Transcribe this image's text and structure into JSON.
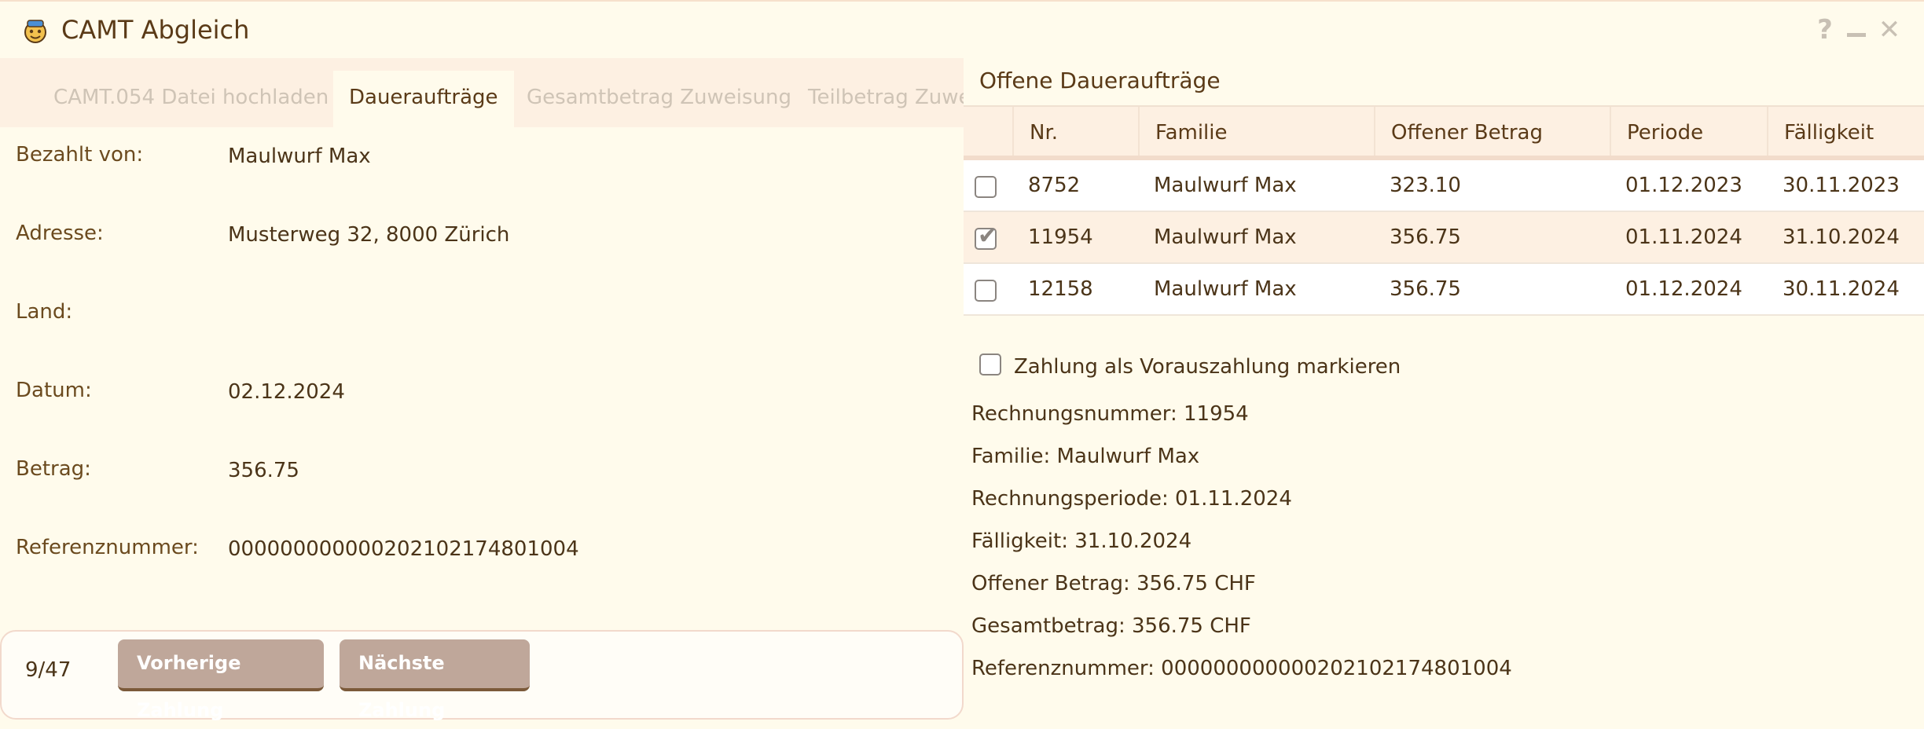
{
  "window": {
    "title": "CAMT Abgleich",
    "help_glyph": "?",
    "minimize_glyph": "_",
    "close_glyph": "✕"
  },
  "tabs": [
    {
      "label": "CAMT.054 Datei hochladen",
      "active": false
    },
    {
      "label": "Daueraufträge",
      "active": true
    },
    {
      "label": "Gesamtbetrag Zuweisung",
      "active": false
    },
    {
      "label": "Teilbetrag Zuweisung",
      "active": false
    }
  ],
  "payment": {
    "fields": [
      {
        "label": "Bezahlt von:",
        "value": "Maulwurf Max"
      },
      {
        "label": "Adresse:",
        "value": "Musterweg 32, 8000 Zürich"
      },
      {
        "label": "Land:",
        "value": ""
      },
      {
        "label": "Datum:",
        "value": "02.12.2024"
      },
      {
        "label": "Betrag:",
        "value": "356.75"
      },
      {
        "label": "Referenznummer:",
        "value": "000000000000202102174801004"
      }
    ],
    "counter": "9/47",
    "prev_label": "Vorherige Zahlung",
    "next_label": "Nächste Zahlung"
  },
  "orders": {
    "title": "Offene Daueraufträge",
    "columns": [
      "",
      "Nr.",
      "Familie",
      "Offener Betrag",
      "Periode",
      "Fälligkeit"
    ],
    "rows": [
      {
        "checked": false,
        "nr": "8752",
        "familie": "Maulwurf Max",
        "betrag": "323.10",
        "periode": "01.12.2023",
        "faelligkeit": "30.11.2023"
      },
      {
        "checked": true,
        "nr": "11954",
        "familie": "Maulwurf Max",
        "betrag": "356.75",
        "periode": "01.11.2024",
        "faelligkeit": "31.10.2024"
      },
      {
        "checked": false,
        "nr": "12158",
        "familie": "Maulwurf Max",
        "betrag": "356.75",
        "periode": "01.12.2024",
        "faelligkeit": "30.11.2024"
      }
    ],
    "prepay_label": "Zahlung als Vorauszahlung markieren",
    "prepay_checked": false
  },
  "details": [
    "Rechnungsnummer: 11954",
    "Familie: Maulwurf Max",
    "Rechnungsperiode: 01.11.2024",
    "Fälligkeit: 31.10.2024",
    "Offener Betrag: 356.75 CHF",
    "Gesamtbetrag: 356.75 CHF",
    "Referenznummer: 000000000000202102174801004"
  ],
  "colors": {
    "background": "#fffbec",
    "tab_strip": "#fdf0e2",
    "button": "#bfa79a",
    "text": "#4b3418"
  }
}
